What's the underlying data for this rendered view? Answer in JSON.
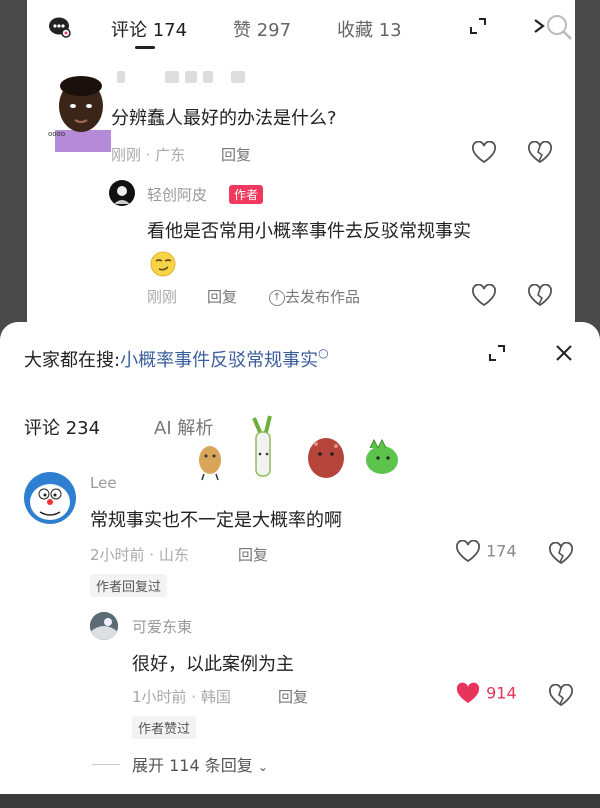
{
  "top_card": {
    "tabs": [
      {
        "label": "评论 174"
      },
      {
        "label": "赞 297"
      },
      {
        "label": "收藏 13"
      }
    ],
    "comment": {
      "text": "分辨蠢人最好的办法是什么?",
      "meta": "刚刚 · 广东",
      "reply_label": "回复"
    },
    "reply": {
      "username": "轻创阿皮",
      "badge": "作者",
      "text": "看他是否常用小概率事件去反驳常规事实",
      "meta": "刚刚",
      "reply_label": "回复",
      "publish_label": "去发布作品"
    }
  },
  "sheet": {
    "search_prefix": "大家都在搜:",
    "search_term": "小概率事件反驳常规事实",
    "tabs": [
      {
        "label": "评论 234"
      },
      {
        "label": "AI 解析"
      }
    ],
    "comment1": {
      "username": "Lee",
      "text": "常规事实也不一定是大概率的啊",
      "meta": "2小时前 · 山东",
      "reply_label": "回复",
      "like_count": "174",
      "author_tag": "作者回复过"
    },
    "comment2": {
      "username": "可爱东東",
      "text": "很好，以此案例为主",
      "meta": "1小时前 · 韩国",
      "reply_label": "回复",
      "like_count": "914",
      "author_tag": "作者赞过"
    },
    "expand_label": "展开 114 条回复"
  },
  "colors": {
    "accent_pink": "#f0395c",
    "search_link": "#3a5d9c",
    "liked_heart": "#e8345a"
  }
}
